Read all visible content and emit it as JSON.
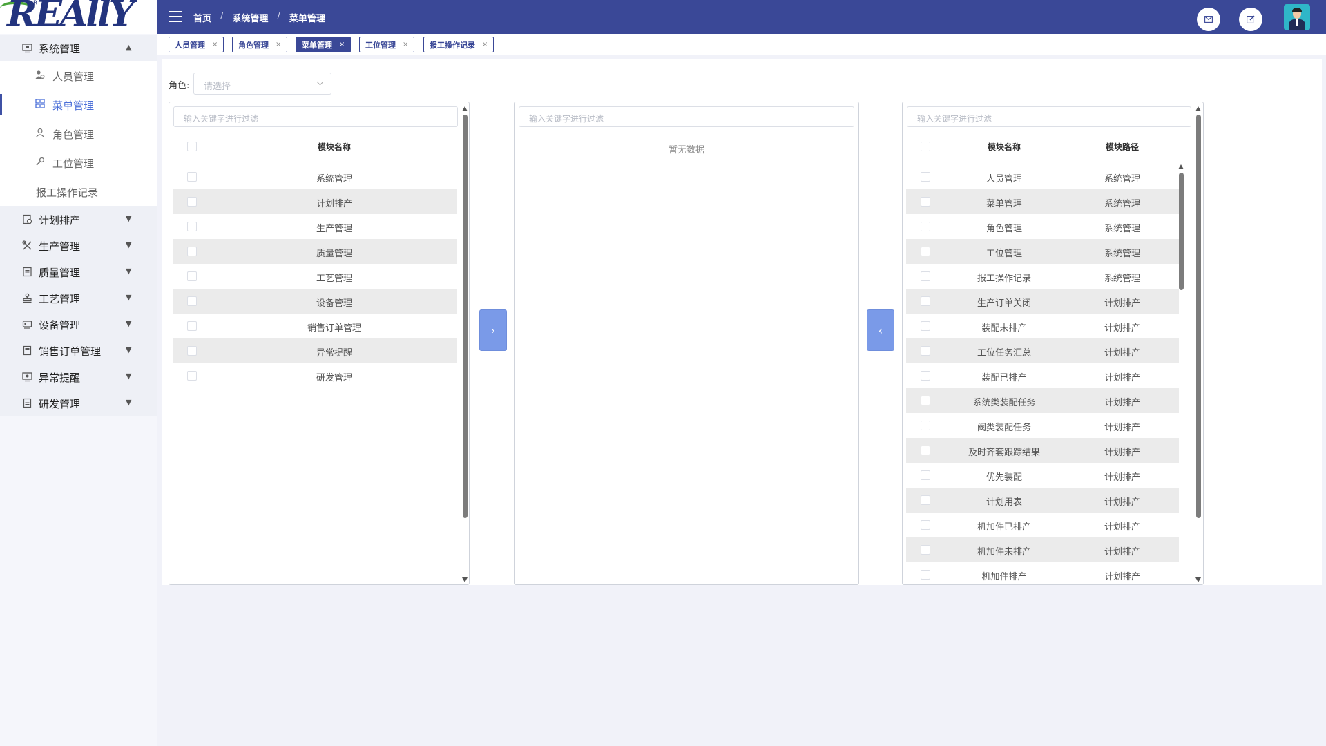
{
  "logo": {
    "text": "REAllY",
    "tm": "R"
  },
  "breadcrumb": [
    "首页",
    "系统管理",
    "菜单管理"
  ],
  "header_icons": [
    "mail-icon",
    "edit-icon",
    "user-avatar"
  ],
  "sidebar": {
    "groups": [
      {
        "label": "系统管理",
        "icon": "monitor-icon",
        "expanded": true,
        "items": [
          {
            "label": "人员管理",
            "icon": "users-icon"
          },
          {
            "label": "菜单管理",
            "icon": "grid-icon",
            "active": true
          },
          {
            "label": "角色管理",
            "icon": "user-icon"
          },
          {
            "label": "工位管理",
            "icon": "wrench-icon"
          },
          {
            "label": "报工操作记录",
            "icon": ""
          }
        ]
      },
      {
        "label": "计划排产",
        "icon": "calendar-icon"
      },
      {
        "label": "生产管理",
        "icon": "tools-icon"
      },
      {
        "label": "质量管理",
        "icon": "clipboard-icon"
      },
      {
        "label": "工艺管理",
        "icon": "stamp-icon"
      },
      {
        "label": "设备管理",
        "icon": "device-icon"
      },
      {
        "label": "销售订单管理",
        "icon": "order-icon"
      },
      {
        "label": "异常提醒",
        "icon": "alert-icon"
      },
      {
        "label": "研发管理",
        "icon": "doc-icon"
      }
    ]
  },
  "tabs": [
    {
      "label": "人员管理",
      "active": false
    },
    {
      "label": "角色管理",
      "active": false
    },
    {
      "label": "菜单管理",
      "active": true
    },
    {
      "label": "工位管理",
      "active": false
    },
    {
      "label": "报工操作记录",
      "active": false
    }
  ],
  "tab_close": "×",
  "role": {
    "label": "角色:",
    "placeholder": "请选择"
  },
  "left_panel": {
    "filter_placeholder": "输入关键字进行过滤",
    "col_name": "模块名称",
    "rows": [
      "系统管理",
      "计划排产",
      "生产管理",
      "质量管理",
      "工艺管理",
      "设备管理",
      "销售订单管理",
      "异常提醒",
      "研发管理"
    ]
  },
  "middle_panel": {
    "filter_placeholder": "输入关键字进行过滤",
    "empty_text": "暂无数据"
  },
  "right_panel": {
    "filter_placeholder": "输入关键字进行过滤",
    "col_name": "模块名称",
    "col_path": "模块路径",
    "rows": [
      {
        "name": "人员管理",
        "path": "系统管理"
      },
      {
        "name": "菜单管理",
        "path": "系统管理"
      },
      {
        "name": "角色管理",
        "path": "系统管理"
      },
      {
        "name": "工位管理",
        "path": "系统管理"
      },
      {
        "name": "报工操作记录",
        "path": "系统管理"
      },
      {
        "name": "生产订单关闭",
        "path": "计划排产"
      },
      {
        "name": "装配未排产",
        "path": "计划排产"
      },
      {
        "name": "工位任务汇总",
        "path": "计划排产"
      },
      {
        "name": "装配已排产",
        "path": "计划排产"
      },
      {
        "name": "系统类装配任务",
        "path": "计划排产"
      },
      {
        "name": "阀类装配任务",
        "path": "计划排产"
      },
      {
        "name": "及时齐套跟踪结果",
        "path": "计划排产"
      },
      {
        "name": "优先装配",
        "path": "计划排产"
      },
      {
        "name": "计划用表",
        "path": "计划排产"
      },
      {
        "name": "机加件已排产",
        "path": "计划排产"
      },
      {
        "name": "机加件未排产",
        "path": "计划排产"
      },
      {
        "name": "机加件排产",
        "path": "计划排产"
      }
    ]
  },
  "transfer": {
    "right_arrow": "›",
    "left_arrow": "‹"
  },
  "colors": {
    "primary": "#3a4897",
    "accent": "#4b6fd8",
    "transfer_button": "#7a9ae8"
  }
}
